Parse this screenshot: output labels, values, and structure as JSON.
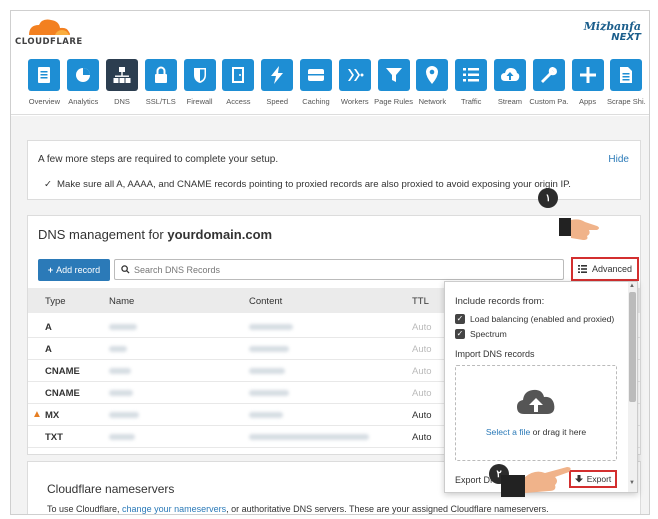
{
  "header": {
    "logo_text": "CLOUDFLARE",
    "brand_name": "Mizbanfa",
    "brand_sub": "NEXT"
  },
  "nav": [
    {
      "label": "Overview",
      "icon": "overview-icon"
    },
    {
      "label": "Analytics",
      "icon": "analytics-icon"
    },
    {
      "label": "DNS",
      "icon": "dns-icon",
      "active": true
    },
    {
      "label": "SSL/TLS",
      "icon": "lock-icon"
    },
    {
      "label": "Firewall",
      "icon": "shield-icon"
    },
    {
      "label": "Access",
      "icon": "door-icon"
    },
    {
      "label": "Speed",
      "icon": "lightning-icon"
    },
    {
      "label": "Caching",
      "icon": "server-icon"
    },
    {
      "label": "Workers",
      "icon": "workers-icon"
    },
    {
      "label": "Page Rules",
      "icon": "filter-icon"
    },
    {
      "label": "Network",
      "icon": "pin-icon"
    },
    {
      "label": "Traffic",
      "icon": "list-icon"
    },
    {
      "label": "Stream",
      "icon": "cloud-upload-icon"
    },
    {
      "label": "Custom Pa...",
      "icon": "wrench-icon"
    },
    {
      "label": "Apps",
      "icon": "plus-icon"
    },
    {
      "label": "Scrape Shi...",
      "icon": "document-icon"
    }
  ],
  "setup": {
    "title": "A few more steps are required to complete your setup.",
    "hide": "Hide",
    "check": "Make sure all A, AAAA, and CNAME records pointing to proxied records are also proxied to avoid exposing your origin IP."
  },
  "dns": {
    "title_prefix": "DNS management for ",
    "domain": "yourdomain.com",
    "add_record": "Add record",
    "search_placeholder": "Search DNS Records",
    "advanced": "Advanced",
    "columns": {
      "type": "Type",
      "name": "Name",
      "content": "Content",
      "ttl": "TTL"
    },
    "rows": [
      {
        "type": "A",
        "ttl": "Auto",
        "warn": false
      },
      {
        "type": "A",
        "ttl": "Auto",
        "warn": false
      },
      {
        "type": "CNAME",
        "ttl": "Auto",
        "warn": false
      },
      {
        "type": "CNAME",
        "ttl": "Auto",
        "warn": false
      },
      {
        "type": "MX",
        "ttl": "Auto",
        "warn": true
      },
      {
        "type": "TXT",
        "ttl": "Auto",
        "warn": false
      }
    ]
  },
  "nameservers": {
    "title": "Cloudflare nameservers",
    "text_before": "To use Cloudflare, ",
    "link": "change your nameservers",
    "text_after": ", or authoritative DNS servers. These are your assigned Cloudflare nameservers."
  },
  "dropdown": {
    "include_title": "Include records from:",
    "opt_lb": "Load balancing (enabled and proxied)",
    "opt_spectrum": "Spectrum",
    "import_title": "Import DNS records",
    "select_file": "Select a file",
    "drag_text": " or drag it here",
    "export_label": "Export DNS records",
    "export_button": "Export"
  },
  "annotations": {
    "step1": "١",
    "step2": "٢"
  },
  "colors": {
    "accent": "#1e8ed4",
    "active_tile": "#2c3e50",
    "highlight": "#d32f2f",
    "link": "#2b7ab8"
  }
}
